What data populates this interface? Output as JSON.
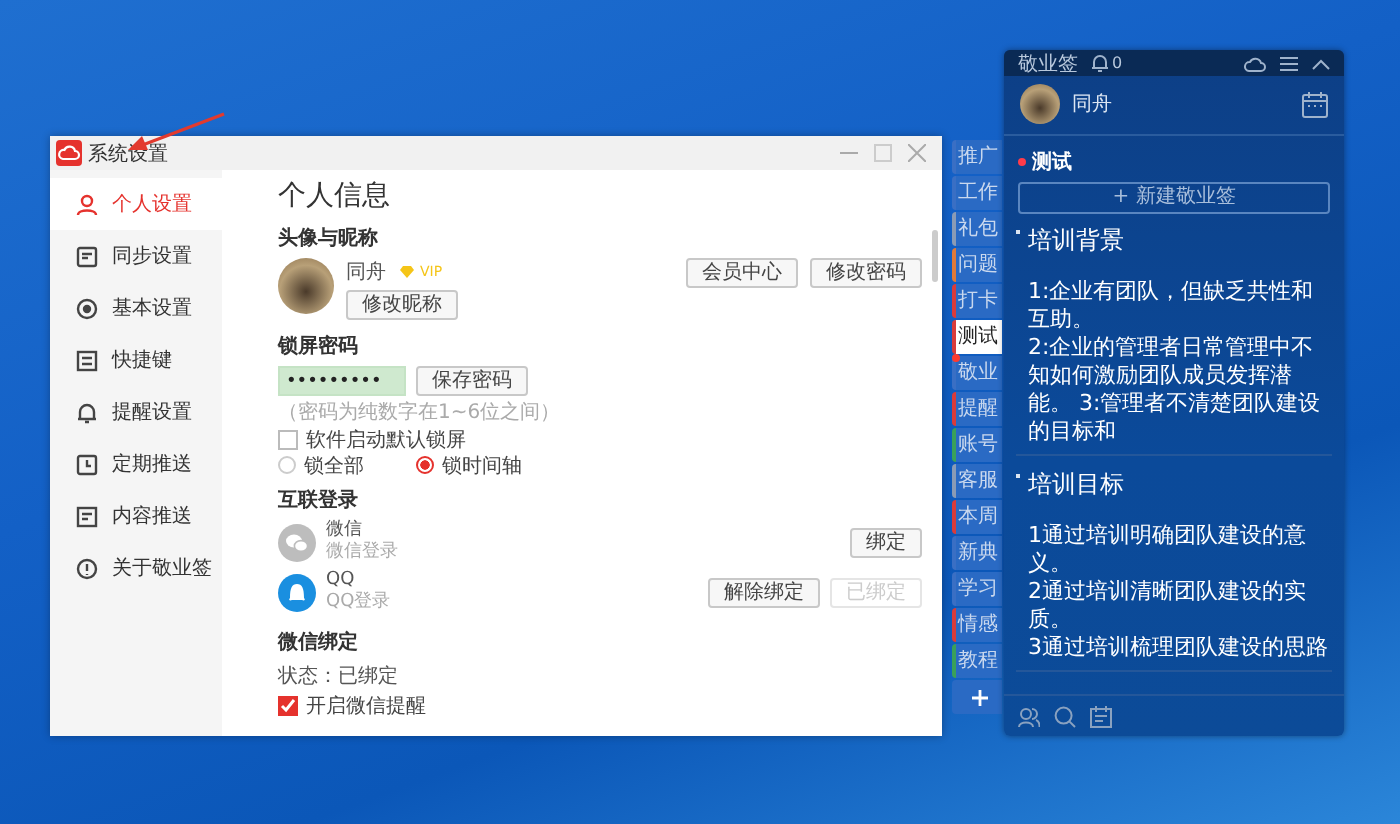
{
  "settings_window": {
    "title": "系统设置",
    "sidebar": {
      "items": [
        {
          "label": "个人设置",
          "selected": true,
          "kind": "person"
        },
        {
          "label": "同步设置",
          "selected": false,
          "kind": "sync"
        },
        {
          "label": "基本设置",
          "selected": false,
          "kind": "target"
        },
        {
          "label": "快捷键",
          "selected": false,
          "kind": "keyboard"
        },
        {
          "label": "提醒设置",
          "selected": false,
          "kind": "bell"
        },
        {
          "label": "定期推送",
          "selected": false,
          "kind": "clock"
        },
        {
          "label": "内容推送",
          "selected": false,
          "kind": "doc"
        },
        {
          "label": "关于敬业签",
          "selected": false,
          "kind": "info"
        }
      ]
    },
    "heading": "个人信息",
    "profile": {
      "title": "头像与昵称",
      "name": "同舟",
      "badge": "VIP",
      "rename_button": "修改昵称",
      "buttons": [
        "会员中心",
        "修改密码"
      ]
    },
    "lock": {
      "title": "锁屏密码",
      "password": "•••••••••",
      "save_button": "保存密码",
      "hint": "（密码为纯数字在1~6位之间）",
      "checkbox": {
        "label": "软件启动默认锁屏",
        "checked": false
      },
      "radios": [
        {
          "label": "锁全部",
          "selected": false
        },
        {
          "label": "锁时间轴",
          "selected": true
        }
      ]
    },
    "connect": {
      "title": "互联登录",
      "accounts": [
        {
          "kind": "wechat",
          "name": "微信",
          "subtitle": "微信登录",
          "buttons": [
            {
              "label": "绑定",
              "disabled": false
            }
          ]
        },
        {
          "kind": "qq",
          "name": "QQ",
          "subtitle": "QQ登录",
          "buttons": [
            {
              "label": "解除绑定",
              "disabled": false
            },
            {
              "label": "已绑定",
              "disabled": true
            }
          ]
        }
      ]
    },
    "wechat_binding": {
      "title": "微信绑定",
      "status": "状态：已绑定",
      "checkbox": {
        "label": "开启微信提醒",
        "checked": true
      }
    }
  },
  "side_tabs": [
    {
      "label": "推广",
      "selected": false,
      "unread": false,
      "color": "#3a6fc4"
    },
    {
      "label": "工作",
      "selected": false,
      "unread": false,
      "color": "#3a6fc4"
    },
    {
      "label": "礼包",
      "selected": false,
      "unread": false,
      "color": "#8a9bb5"
    },
    {
      "label": "问题",
      "selected": false,
      "unread": false,
      "color": "#e07a3a"
    },
    {
      "label": "打卡",
      "selected": false,
      "unread": false,
      "color": "#d93b3b"
    },
    {
      "label": "测试",
      "selected": true,
      "unread": false,
      "color": "#d93b3b"
    },
    {
      "label": "敬业",
      "selected": false,
      "unread": true,
      "color": "#3a6fc4"
    },
    {
      "label": "提醒",
      "selected": false,
      "unread": false,
      "color": "#d93b3b"
    },
    {
      "label": "账号",
      "selected": false,
      "unread": false,
      "color": "#3aa05a"
    },
    {
      "label": "客服",
      "selected": false,
      "unread": false,
      "color": "#8a9bb5"
    },
    {
      "label": "本周",
      "selected": false,
      "unread": false,
      "color": "#d93b3b"
    },
    {
      "label": "新典",
      "selected": false,
      "unread": false,
      "color": "#3a6fc4"
    },
    {
      "label": "学习",
      "selected": false,
      "unread": false,
      "color": "#3a6fc4"
    },
    {
      "label": "情感",
      "selected": false,
      "unread": false,
      "color": "#d93b3b"
    },
    {
      "label": "教程",
      "selected": false,
      "unread": false,
      "color": "#3aa05a"
    }
  ],
  "notes_panel": {
    "title": "敬业签",
    "notification_count": "0",
    "user_name": "同舟",
    "category": "测试",
    "new_button": "+ 新建敬业签",
    "notes": [
      {
        "title": "培训背景",
        "body": "1:企业有团队，但缺乏共性和互助。\n2:企业的管理者日常管理中不知如何激励团队成员发挥潜能。 3:管理者不清楚团队建设的目标和"
      },
      {
        "title": "培训目标",
        "body": "1通过培训明确团队建设的意义。\n2通过培训清晰团队建设的实质。\n3通过培训梳理团队建设的思路"
      }
    ]
  }
}
